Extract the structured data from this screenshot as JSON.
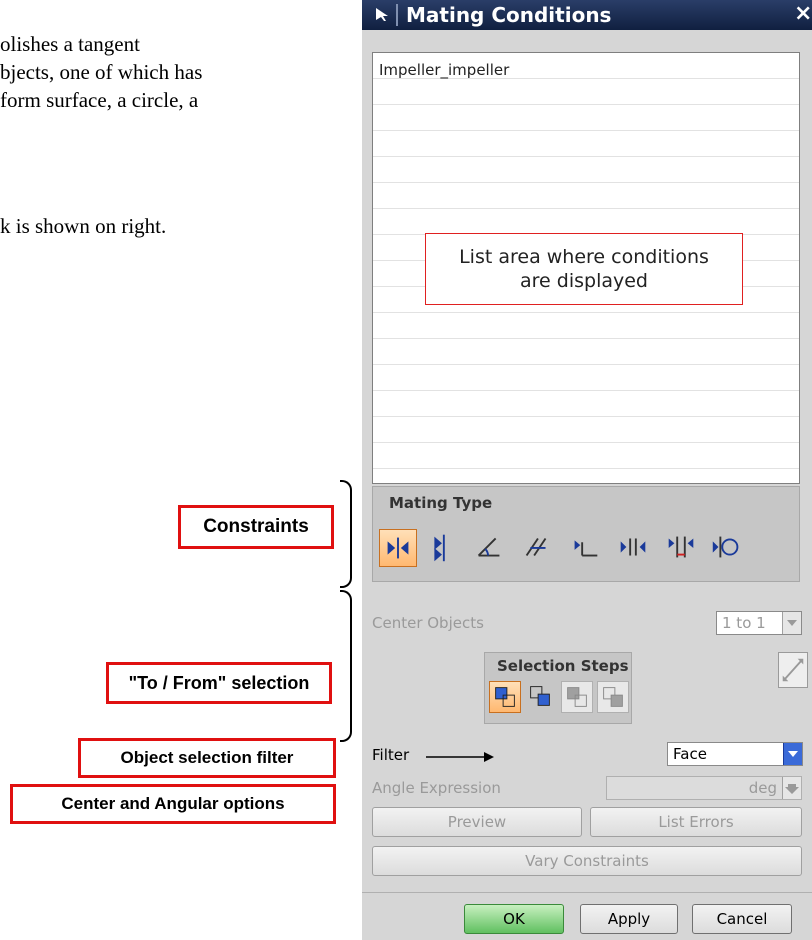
{
  "document": {
    "lines": [
      "olishes a tangent",
      "bjects, one of which has",
      " form surface, a circle, a",
      "k is shown on right."
    ]
  },
  "dialog": {
    "title": "Mating Conditions",
    "close_glyph": "×",
    "list": {
      "items": [
        "Impeller_impeller"
      ],
      "callout": "List area where conditions\nare displayed"
    },
    "mating_type": {
      "title": "Mating Type",
      "icons": [
        "mate-icon",
        "align-icon",
        "angle-icon",
        "parallel-icon",
        "perpendicular-icon",
        "center-icon",
        "distance-icon",
        "tangent-icon"
      ],
      "selected_index": 0
    },
    "center_objects": {
      "label": "Center Objects",
      "value": "1 to 1"
    },
    "selection_steps": {
      "title": "Selection Steps",
      "icons": [
        "from-face-icon",
        "to-face-icon",
        "from-object-icon",
        "to-object-icon"
      ]
    },
    "filter": {
      "label": "Filter",
      "value": "Face"
    },
    "angle_expression": {
      "label": "Angle Expression",
      "unit": "deg"
    },
    "buttons": {
      "preview": "Preview",
      "list_errors": "List Errors",
      "vary_constraints": "Vary Constraints",
      "ok": "OK",
      "apply": "Apply",
      "cancel": "Cancel"
    }
  },
  "annotations": {
    "constraints": "Constraints",
    "to_from": "\"To / From\" selection",
    "object_filter": "Object selection filter",
    "center_angular": "Center and Angular options"
  },
  "colors": {
    "title_bar": "#1b2d52",
    "highlight": "#e01010",
    "selected_button": "#ffb870",
    "ok_button": "#60c060"
  }
}
